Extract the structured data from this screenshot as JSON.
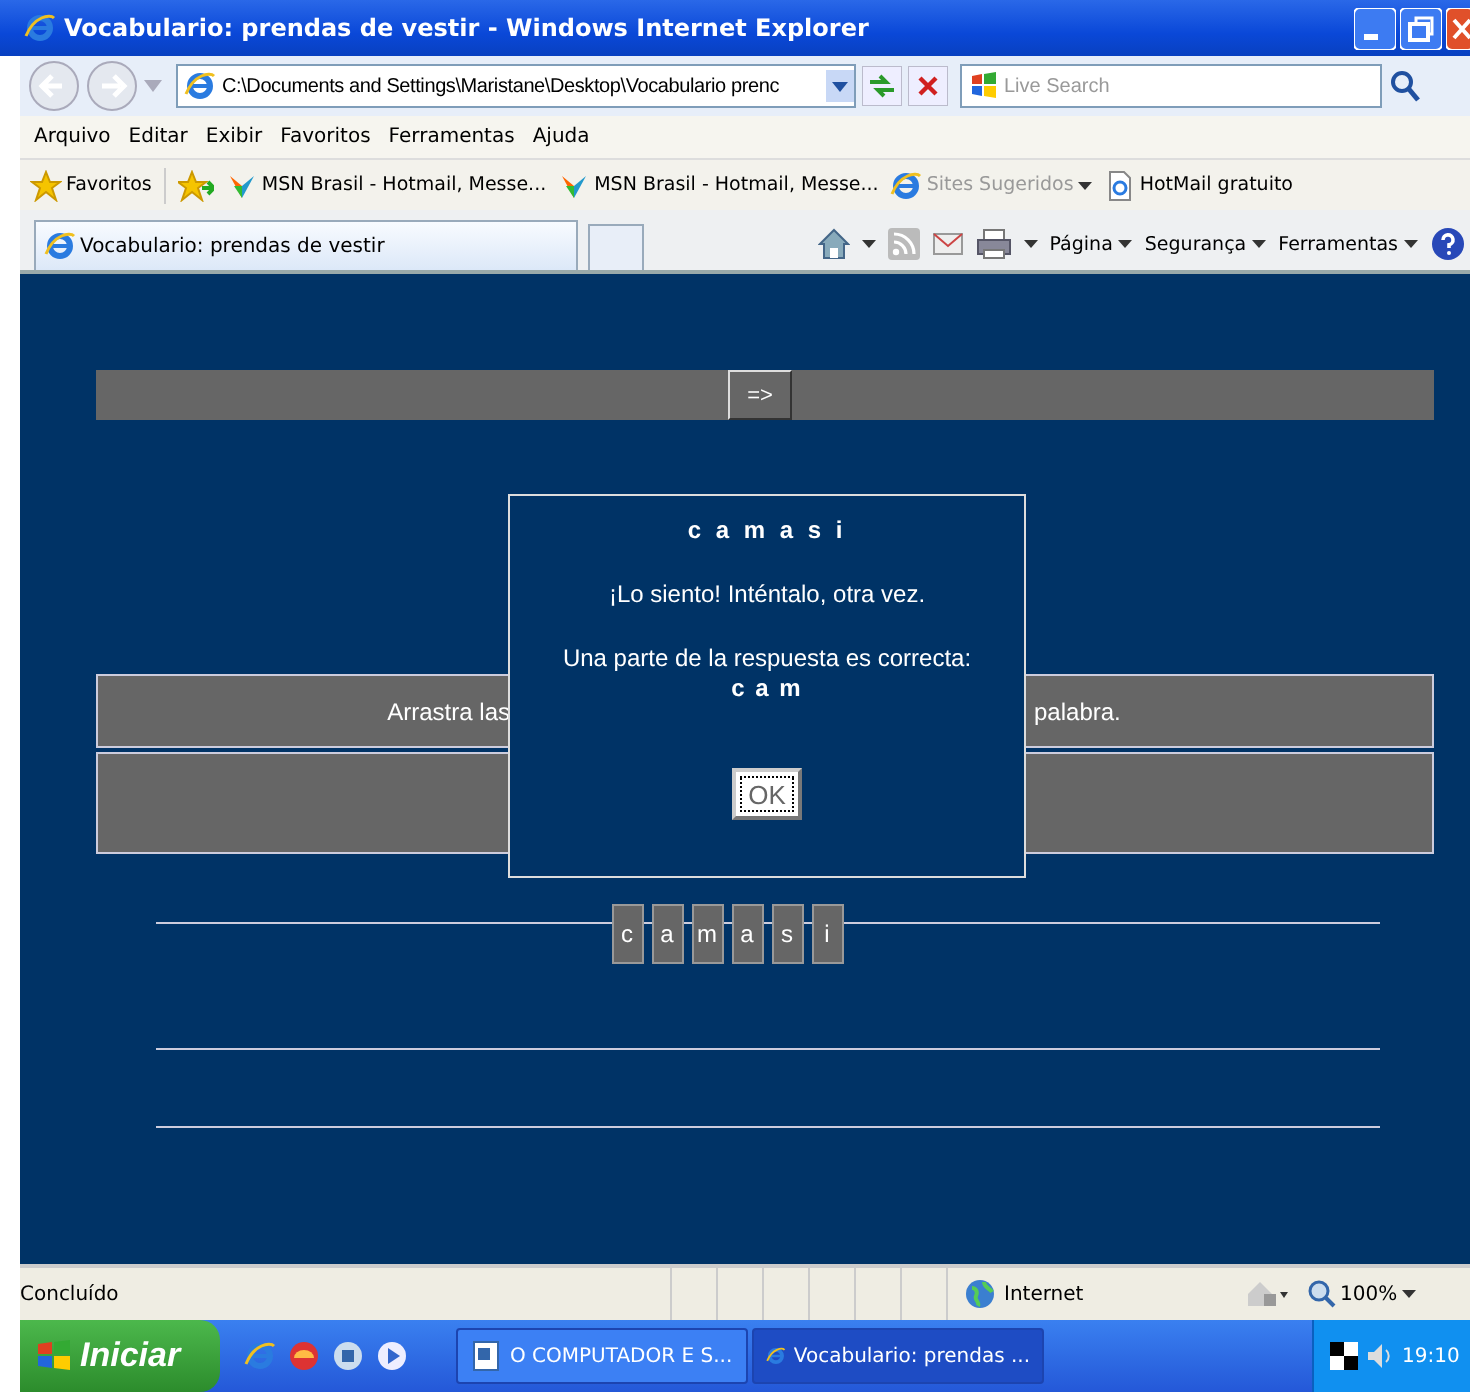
{
  "window": {
    "title": "Vocabulario: prendas de vestir - Windows Internet Explorer"
  },
  "address_bar": {
    "value": "C:\\Documents and Settings\\Maristane\\Desktop\\Vocabulario prenc",
    "search_placeholder": "Live Search"
  },
  "menu": [
    "Arquivo",
    "Editar",
    "Exibir",
    "Favoritos",
    "Ferramentas",
    "Ajuda"
  ],
  "favorites_bar": [
    {
      "label": "Favoritos",
      "kind": "star",
      "disabled": false
    },
    {
      "label": "MSN Brasil - Hotmail, Messe...",
      "kind": "msn",
      "disabled": false
    },
    {
      "label": "MSN Brasil - Hotmail, Messe...",
      "kind": "msn",
      "disabled": false
    },
    {
      "label": "Sites Sugeridos",
      "kind": "sites",
      "disabled": true
    },
    {
      "label": "HotMail gratuito",
      "kind": "page",
      "disabled": false
    }
  ],
  "tab": {
    "label": "Vocabulario: prendas de vestir",
    "selected": true
  },
  "command_bar": [
    "Página",
    "Segurança",
    "Ferramentas"
  ],
  "page": {
    "nav_button": "=>",
    "instruction_parts": [
      "Arrastra las",
      "palabra."
    ],
    "letters": [
      "c",
      "a",
      "m",
      "a",
      "s",
      "i"
    ]
  },
  "dialog": {
    "title": "c a m a s i",
    "message": "¡Lo siento! Inténtalo, otra vez.",
    "partial_label": "Una parte de la respuesta es correcta:",
    "partial_answer": "c a m",
    "button": "OK"
  },
  "status_bar": {
    "text": "Concluído",
    "zone": "Internet",
    "zoom": "100%"
  },
  "taskbar": {
    "start": "Iniciar",
    "tasks": [
      {
        "label": "O COMPUTADOR E S...",
        "selected": false
      },
      {
        "label": "Vocabulario: prendas ...",
        "selected": true
      }
    ],
    "clock": "19:10"
  }
}
